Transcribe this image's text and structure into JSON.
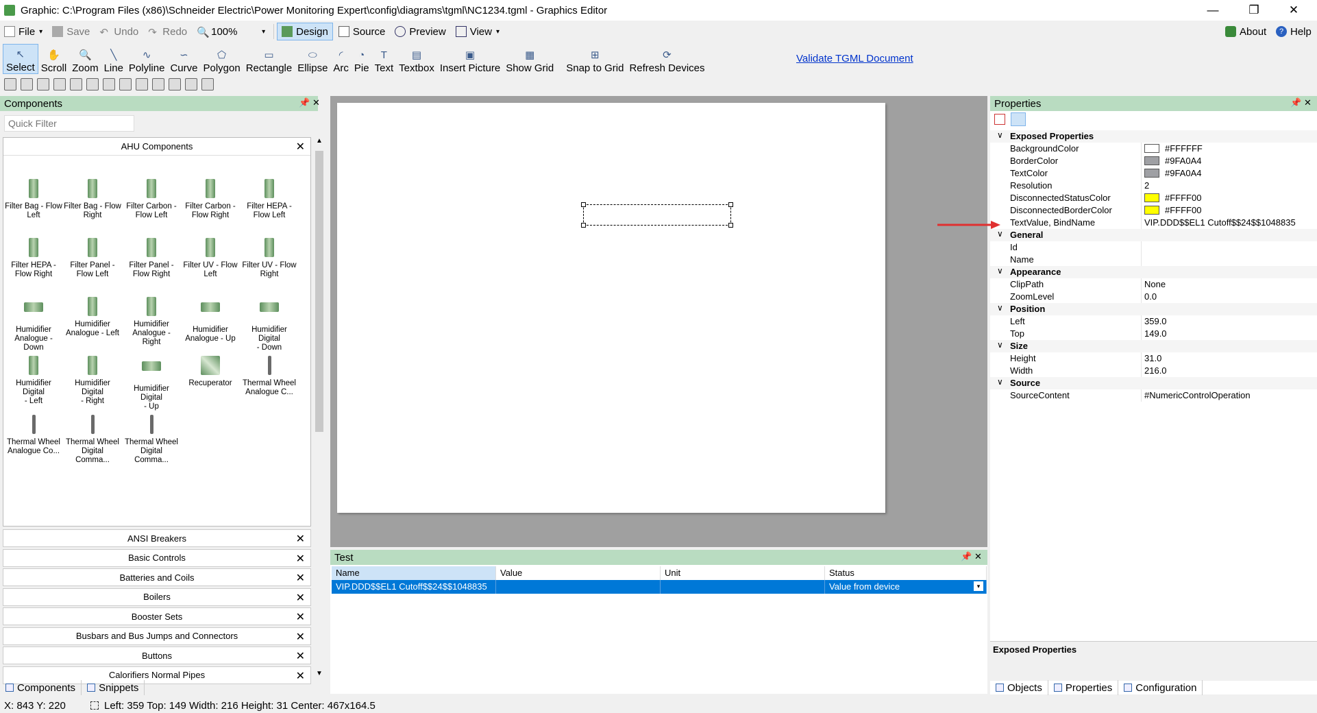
{
  "window": {
    "title": "Graphic: C:\\Program Files (x86)\\Schneider Electric\\Power Monitoring Expert\\config\\diagrams\\tgml\\NC1234.tgml - Graphics Editor"
  },
  "menu": {
    "file": "File",
    "save": "Save",
    "undo": "Undo",
    "redo": "Redo",
    "zoom": "100%",
    "design": "Design",
    "source": "Source",
    "preview": "Preview",
    "view": "View",
    "about": "About",
    "help": "Help"
  },
  "tools": [
    "Select",
    "Scroll",
    "Zoom",
    "Line",
    "Polyline",
    "Curve",
    "Polygon",
    "Rectangle",
    "Ellipse",
    "Arc",
    "Pie",
    "Text",
    "Textbox",
    "Insert Picture",
    "Show Grid",
    "Snap to Grid",
    "Refresh Devices"
  ],
  "validate": "Validate TGML Document",
  "components": {
    "title": "Components",
    "filter_placeholder": "Quick Filter",
    "group": "AHU Components",
    "items": [
      {
        "line1": "Filter Bag - Flow",
        "line2": "Left"
      },
      {
        "line1": "Filter Bag - Flow",
        "line2": "Right"
      },
      {
        "line1": "Filter Carbon -",
        "line2": "Flow Left"
      },
      {
        "line1": "Filter Carbon -",
        "line2": "Flow Right"
      },
      {
        "line1": "Filter HEPA -",
        "line2": "Flow Left"
      },
      {
        "line1": "Filter HEPA -",
        "line2": "Flow Right"
      },
      {
        "line1": "Filter Panel -",
        "line2": "Flow Left"
      },
      {
        "line1": "Filter Panel -",
        "line2": "Flow Right"
      },
      {
        "line1": "Filter UV - Flow",
        "line2": "Left"
      },
      {
        "line1": "Filter UV - Flow",
        "line2": "Right"
      },
      {
        "line1": "Humidifier",
        "line2": "Analogue - Down"
      },
      {
        "line1": "Humidifier",
        "line2": "Analogue - Left"
      },
      {
        "line1": "Humidifier",
        "line2": "Analogue - Right"
      },
      {
        "line1": "Humidifier",
        "line2": "Analogue - Up"
      },
      {
        "line1": "Humidifier Digital",
        "line2": "- Down"
      },
      {
        "line1": "Humidifier Digital",
        "line2": "- Left"
      },
      {
        "line1": "Humidifier Digital",
        "line2": "- Right"
      },
      {
        "line1": "Humidifier Digital",
        "line2": "- Up"
      },
      {
        "line1": "Recuperator",
        "line2": ""
      },
      {
        "line1": "Thermal Wheel",
        "line2": "Analogue C..."
      },
      {
        "line1": "Thermal Wheel",
        "line2": "Analogue Co..."
      },
      {
        "line1": "Thermal Wheel",
        "line2": "Digital Comma..."
      },
      {
        "line1": "Thermal Wheel",
        "line2": "Digital Comma..."
      }
    ],
    "categories": [
      "ANSI Breakers",
      "Basic Controls",
      "Batteries and Coils",
      "Boilers",
      "Booster Sets",
      "Busbars and Bus Jumps and Connectors",
      "Buttons",
      "Calorifiers Normal Pipes"
    ],
    "tabs": {
      "components": "Components",
      "snippets": "Snippets"
    }
  },
  "test": {
    "title": "Test",
    "columns": [
      "Name",
      "Value",
      "Unit",
      "Status"
    ],
    "row": {
      "name": "VIP.DDD$$EL1 Cutoff$$24$$1048835",
      "value": "",
      "unit": "",
      "status": "Value from device"
    }
  },
  "properties": {
    "title": "Properties",
    "sections": [
      {
        "name": "Exposed Properties",
        "rows": [
          {
            "k": "BackgroundColor",
            "v": "#FFFFFF",
            "swatch": "#FFFFFF"
          },
          {
            "k": "BorderColor",
            "v": "#9FA0A4",
            "swatch": "#9FA0A4"
          },
          {
            "k": "TextColor",
            "v": "#9FA0A4",
            "swatch": "#9FA0A4"
          },
          {
            "k": "Resolution",
            "v": "2"
          },
          {
            "k": "DisconnectedStatusColor",
            "v": "#FFFF00",
            "swatch": "#FFFF00"
          },
          {
            "k": "DisconnectedBorderColor",
            "v": "#FFFF00",
            "swatch": "#FFFF00"
          },
          {
            "k": "TextValue, BindName",
            "v": "VIP.DDD$$EL1 Cutoff$$24$$1048835"
          }
        ]
      },
      {
        "name": "General",
        "rows": [
          {
            "k": "Id",
            "v": ""
          },
          {
            "k": "Name",
            "v": ""
          }
        ]
      },
      {
        "name": "Appearance",
        "rows": [
          {
            "k": "ClipPath",
            "v": "None"
          },
          {
            "k": "ZoomLevel",
            "v": "0.0"
          }
        ]
      },
      {
        "name": "Position",
        "rows": [
          {
            "k": "Left",
            "v": "359.0"
          },
          {
            "k": "Top",
            "v": "149.0"
          }
        ]
      },
      {
        "name": "Size",
        "rows": [
          {
            "k": "Height",
            "v": "31.0"
          },
          {
            "k": "Width",
            "v": "216.0"
          }
        ]
      },
      {
        "name": "Source",
        "rows": [
          {
            "k": "SourceContent",
            "v": "#NumericControlOperation"
          }
        ]
      }
    ],
    "description_title": "Exposed Properties",
    "tabs": [
      "Objects",
      "Properties",
      "Configuration"
    ]
  },
  "status": {
    "xy": "X: 843  Y: 220",
    "selection": "Left: 359  Top: 149  Width: 216  Height: 31  Center: 467x164.5"
  },
  "colors": {
    "panel_header": "#b9dcc1",
    "selection": "#0078d7",
    "arrow": "#e03030"
  }
}
